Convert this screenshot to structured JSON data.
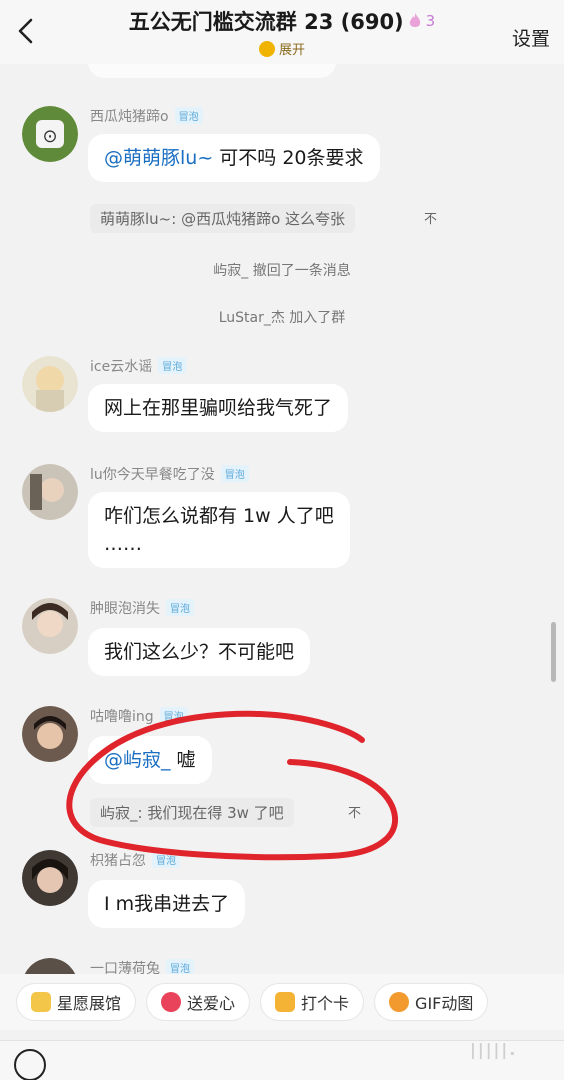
{
  "header": {
    "back_icon": "chevron-left-icon",
    "title": "五公无门槛交流群 23 (690)",
    "fire_icon": "fire-icon",
    "hot_count": "3",
    "expand_label": "展开",
    "settings_label": "设置"
  },
  "messages": [
    {
      "nick": "西瓜炖猪蹄o",
      "tag": "冒泡",
      "text_mention": "@萌萌豚lu~",
      "text": " 可不吗 20条要求",
      "quote": "萌萌豚lu~: @西瓜炖猪蹄o 这么夸张",
      "quote_extra": "不"
    },
    {
      "nick": "ice云水谣",
      "tag": "冒泡",
      "text": "网上在那里骗呗给我气死了"
    },
    {
      "nick": "lu你今天早餐吃了没",
      "tag": "冒泡",
      "text": "咋们怎么说都有 1w 人了吧",
      "text2": "……"
    },
    {
      "nick": "肿眼泡消失",
      "tag": "冒泡",
      "text": "我们这么少？不可能吧"
    },
    {
      "nick": "咕噜噜ing",
      "tag": "冒泡",
      "text_mention": "@屿寂_",
      "text": " 嘘",
      "quote": "屿寂_: 我们现在得 3w 了吧",
      "quote_extra": "不"
    },
    {
      "nick": "枳猪占忽",
      "tag": "冒泡",
      "text": "I    m我串进去了"
    },
    {
      "nick": "一口薄荷兔",
      "tag": "冒泡"
    }
  ],
  "system": {
    "recall": "屿寂_ 撤回了一条消息",
    "join": "LuStar_杰 加入了群"
  },
  "toolbar": {
    "items": [
      {
        "label": "星愿展馆",
        "icon": "star-hall-icon",
        "color": "#f3c64a"
      },
      {
        "label": "送爱心",
        "icon": "heart-icon",
        "color": "#e8435a"
      },
      {
        "label": "打个卡",
        "icon": "checkin-icon",
        "color": "#f5b335"
      },
      {
        "label": "GIF动图",
        "icon": "gif-icon",
        "color": "#f29a2e"
      }
    ]
  },
  "input": {
    "voice_icon": "voice-icon"
  },
  "colors": {
    "annotation": "#e0242c",
    "mention": "#1a6ec2",
    "tag": "#5aa9d9"
  }
}
